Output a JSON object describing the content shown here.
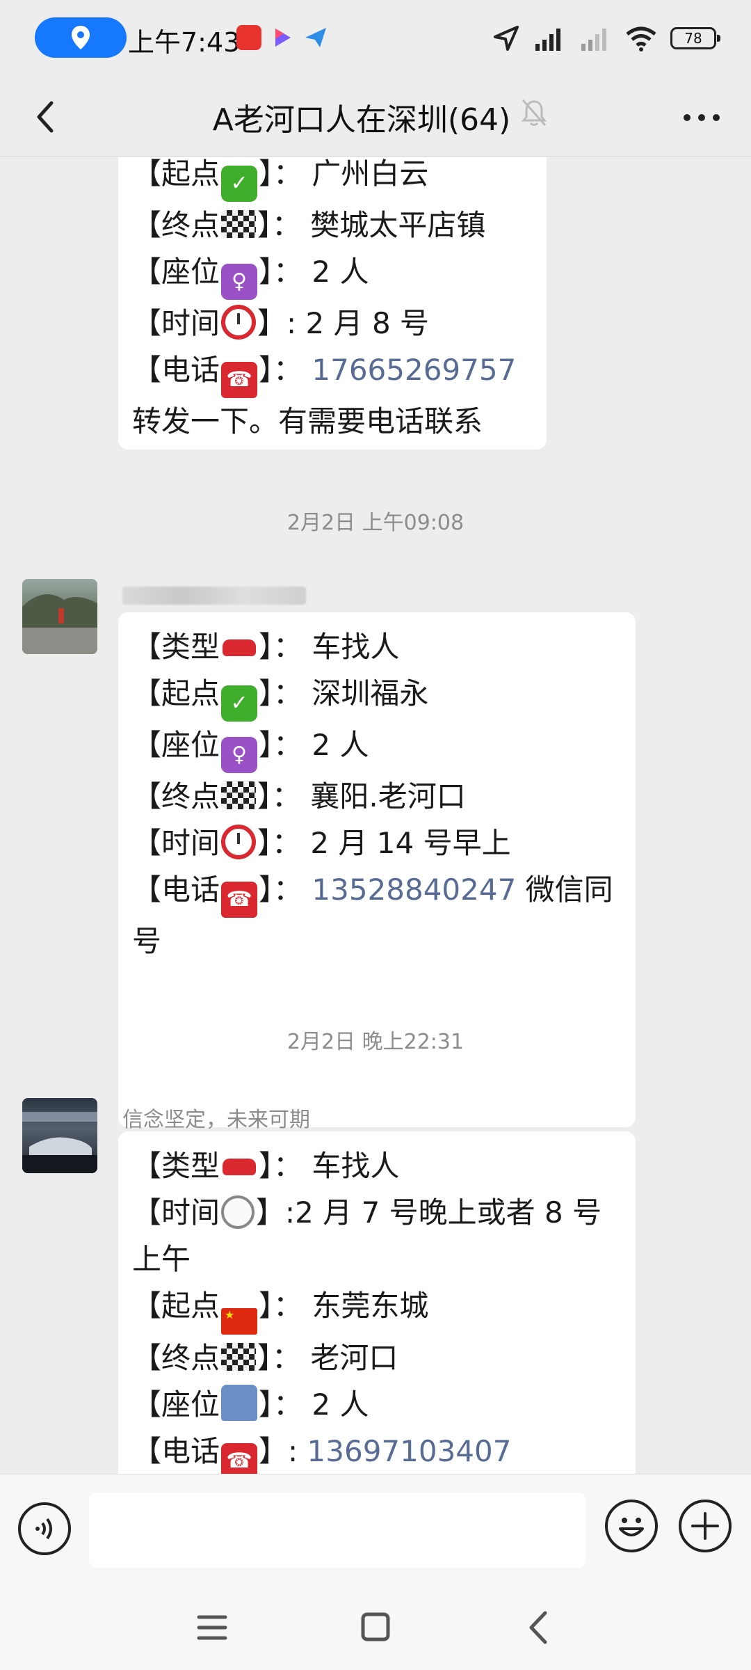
{
  "status_bar": {
    "time": "上午7:43",
    "battery": "78",
    "app_icons": [
      "xiaohongshu-icon",
      "video-app-icon",
      "plane-app-icon"
    ],
    "icons": [
      "location-icon",
      "navigation-arrow-icon",
      "hd-signal-icon",
      "signal-icon",
      "wifi-icon",
      "battery-icon"
    ]
  },
  "header": {
    "title": "A老河口人在深圳(64)",
    "back_icon": "chevron-left-icon",
    "mute_icon": "bell-muted-icon",
    "more_icon": "more-dots-icon"
  },
  "messages": [
    {
      "lines": [
        {
          "label": "【起点",
          "emoji": "check",
          "rest": "】：  广州白云"
        },
        {
          "label": "【终点",
          "emoji": "flag",
          "rest": "】：  樊城太平店镇"
        },
        {
          "label": "【座位",
          "emoji": "person",
          "rest": "】：  2 人"
        },
        {
          "label": "【时间",
          "emoji": "alarm",
          "rest": "】: 2 月 8 号"
        },
        {
          "label": "【电话",
          "emoji": "tel",
          "rest": "】：  ",
          "phone": "17665269757"
        },
        {
          "text": " 转发一下。有需要电话联系"
        }
      ]
    },
    {
      "timestamp": "2月2日 上午09:08",
      "sender": "",
      "lines": [
        {
          "label": "【类型",
          "emoji": "car",
          "rest": "】：  车找人"
        },
        {
          "label": "【起点",
          "emoji": "check",
          "rest": "】：  深圳福永"
        },
        {
          "label": "【座位",
          "emoji": "person",
          "rest": "】：  2 人"
        },
        {
          "label": "【终点",
          "emoji": "flag",
          "rest": "】：  襄阳.老河口"
        },
        {
          "label": "【时间",
          "emoji": "alarm",
          "rest": "】：  2 月 14 号早上"
        },
        {
          "label": "【电话",
          "emoji": "tel",
          "rest": "】：  ",
          "phone": "13528840247",
          "after": " 微信同"
        },
        {
          "text": " 号"
        }
      ]
    },
    {
      "timestamp": "2月2日 晚上22:31",
      "sender": "信念坚定，未来可期",
      "lines": [
        {
          "label": "【类型",
          "emoji": "car",
          "rest": "】：  车找人"
        },
        {
          "label": "【时间",
          "emoji": "clock",
          "rest": "】:2 月 7 号晚上或者 8 号"
        },
        {
          "text": " 上午"
        },
        {
          "label": "【起点",
          "emoji": "cnflag",
          "rest": "】：  东莞东城"
        },
        {
          "label": "【终点",
          "emoji": "flag",
          "rest": "】：  老河口"
        },
        {
          "label": "【座位",
          "emoji": "seat",
          "rest": "】：  2 人"
        },
        {
          "label": "【电话",
          "emoji": "tel",
          "rest": "】: ",
          "phone": "13697103407"
        }
      ]
    }
  ],
  "input_bar": {
    "placeholder": "",
    "voice_icon": "voice-icon",
    "emoji_icon": "smiley-icon",
    "plus_icon": "plus-icon"
  },
  "nav_bar": {
    "icons": [
      "menu-icon",
      "home-square-icon",
      "back-triangle-icon"
    ]
  },
  "colors": {
    "background": "#ededed",
    "bubble": "#ffffff",
    "link": "#576b95",
    "accent": "#1677ff"
  }
}
